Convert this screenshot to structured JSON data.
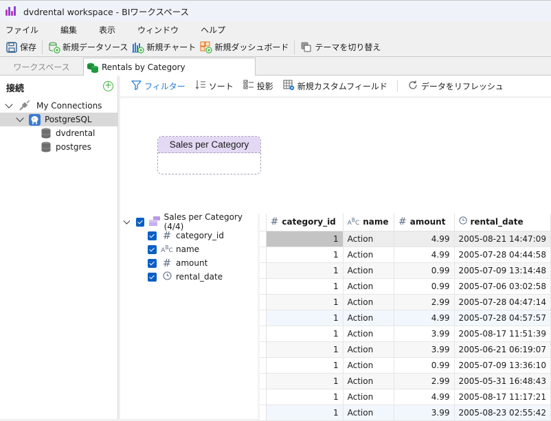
{
  "window": {
    "title": "dvdrental workspace - BIワークスペース",
    "app_icon": "bar-chart-logo-icon"
  },
  "menu": [
    "ファイル",
    "編集",
    "表示",
    "ウィンドウ",
    "ヘルプ"
  ],
  "toolbar": {
    "save": "保存",
    "new_datasource": "新規データソース",
    "new_chart": "新規チャート",
    "new_dashboard": "新規ダッシュボード",
    "toggle_theme": "テーマを切り替え"
  },
  "tabs": {
    "workspace": "ワークスペース",
    "active": "Rentals by Category"
  },
  "connections": {
    "header": "接続",
    "add_icon": "add-circle-icon",
    "root": "My Connections",
    "server": "PostgreSQL",
    "databases": [
      "dvdrental",
      "postgres"
    ]
  },
  "main_toolbar": {
    "filter": "フィルター",
    "sort": "ソート",
    "projection": "投影",
    "new_custom_field": "新規カスタムフィールド",
    "refresh": "データをリフレッシュ"
  },
  "canvas": {
    "node_title": "Sales per Category"
  },
  "fields": {
    "group": "Sales per Category (4/4)",
    "items": [
      {
        "name": "category_id",
        "type": "number",
        "checked": true
      },
      {
        "name": "name",
        "type": "text",
        "checked": true
      },
      {
        "name": "amount",
        "type": "number",
        "checked": true
      },
      {
        "name": "rental_date",
        "type": "datetime",
        "checked": true
      }
    ]
  },
  "grid": {
    "columns": [
      {
        "name": "category_id",
        "type_icon": "#"
      },
      {
        "name": "name",
        "type_icon": "ABC"
      },
      {
        "name": "amount",
        "type_icon": "#"
      },
      {
        "name": "rental_date",
        "type_icon": "clock"
      }
    ],
    "rows": [
      [
        "1",
        "Action",
        "4.99",
        "2005-08-21 14:47:09"
      ],
      [
        "1",
        "Action",
        "4.99",
        "2005-07-28 04:44:58"
      ],
      [
        "1",
        "Action",
        "0.99",
        "2005-07-09 13:14:48"
      ],
      [
        "1",
        "Action",
        "0.99",
        "2005-07-06 03:02:58"
      ],
      [
        "1",
        "Action",
        "2.99",
        "2005-07-28 04:47:14"
      ],
      [
        "1",
        "Action",
        "4.99",
        "2005-07-28 04:57:57"
      ],
      [
        "1",
        "Action",
        "3.99",
        "2005-08-17 11:51:39"
      ],
      [
        "1",
        "Action",
        "3.99",
        "2005-06-21 06:19:07"
      ],
      [
        "1",
        "Action",
        "0.99",
        "2005-07-09 13:36:10"
      ],
      [
        "1",
        "Action",
        "2.99",
        "2005-05-31 16:48:43"
      ],
      [
        "1",
        "Action",
        "4.99",
        "2005-08-17 11:17:21"
      ],
      [
        "1",
        "Action",
        "3.99",
        "2005-08-23 02:55:42"
      ]
    ]
  },
  "colors": {
    "accent_blue": "#0a5fc4",
    "filter_blue": "#1e7ad6",
    "add_green": "#3db33d",
    "node_header": "#e4d9f5"
  }
}
